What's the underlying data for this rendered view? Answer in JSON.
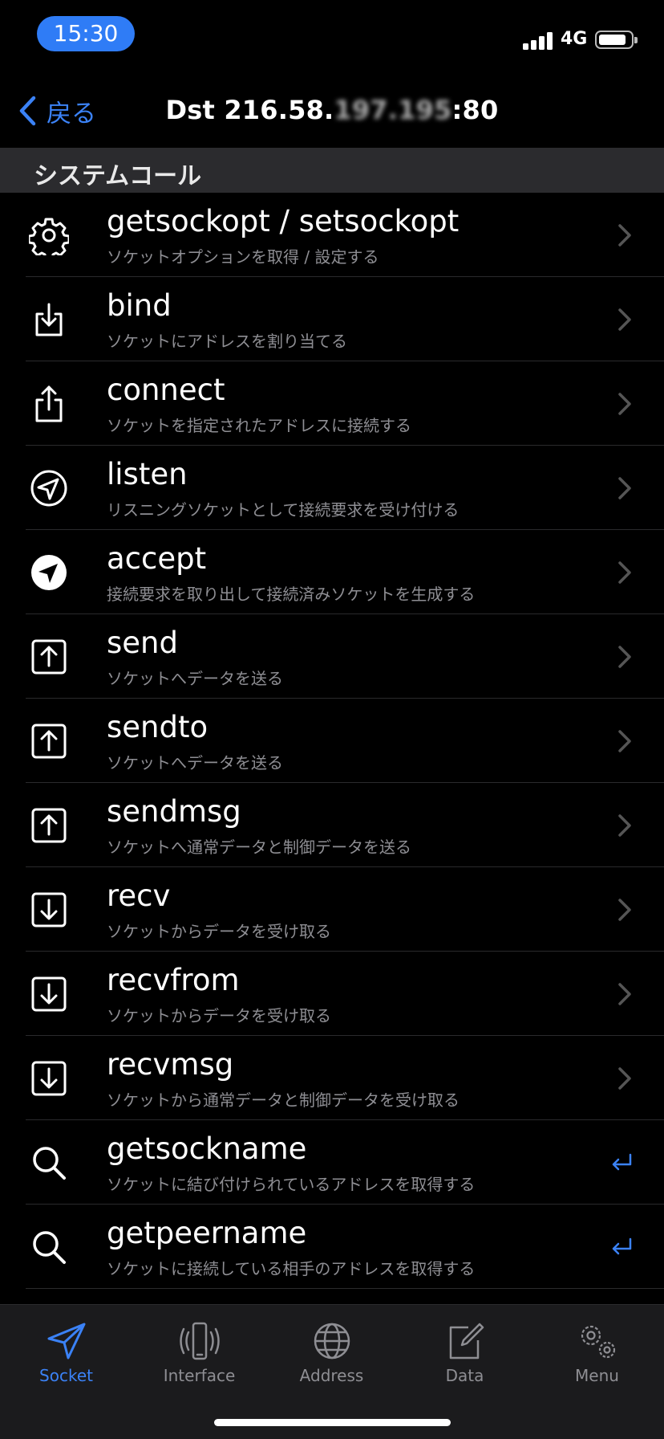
{
  "status_bar": {
    "time": "15:30",
    "network": "4G",
    "icons": [
      "signal-icon",
      "battery-icon"
    ]
  },
  "nav": {
    "back_label": "戻る",
    "title_prefix": "Dst 216.58.",
    "title_blurred": "197.195",
    "title_suffix": ":80"
  },
  "section": {
    "title": "システムコール"
  },
  "rows": [
    {
      "title": "getsockopt / setsockopt",
      "subtitle": "ソケットオプションを取得 / 設定する",
      "icon": "gear-icon",
      "accessory": "chevron"
    },
    {
      "title": "bind",
      "subtitle": "ソケットにアドレスを割り当てる",
      "icon": "tray-download-icon",
      "accessory": "chevron"
    },
    {
      "title": "connect",
      "subtitle": "ソケットを指定されたアドレスに接続する",
      "icon": "share-upload-icon",
      "accessory": "chevron"
    },
    {
      "title": "listen",
      "subtitle": "リスニングソケットとして接続要求を受け付ける",
      "icon": "location-arrow-circle-icon",
      "accessory": "chevron"
    },
    {
      "title": "accept",
      "subtitle": "接続要求を取り出して接続済みソケットを生成する",
      "icon": "location-arrow-filled-icon",
      "accessory": "chevron"
    },
    {
      "title": "send",
      "subtitle": "ソケットへデータを送る",
      "icon": "arrow-up-square-icon",
      "accessory": "chevron"
    },
    {
      "title": "sendto",
      "subtitle": "ソケットへデータを送る",
      "icon": "arrow-up-square-icon",
      "accessory": "chevron"
    },
    {
      "title": "sendmsg",
      "subtitle": "ソケットへ通常データと制御データを送る",
      "icon": "arrow-up-square-icon",
      "accessory": "chevron"
    },
    {
      "title": "recv",
      "subtitle": "ソケットからデータを受け取る",
      "icon": "arrow-down-square-icon",
      "accessory": "chevron"
    },
    {
      "title": "recvfrom",
      "subtitle": "ソケットからデータを受け取る",
      "icon": "arrow-down-square-icon",
      "accessory": "chevron"
    },
    {
      "title": "recvmsg",
      "subtitle": "ソケットから通常データと制御データを受け取る",
      "icon": "arrow-down-square-icon",
      "accessory": "chevron"
    },
    {
      "title": "getsockname",
      "subtitle": "ソケットに結び付けられているアドレスを取得する",
      "icon": "magnifier-icon",
      "accessory": "return"
    },
    {
      "title": "getpeername",
      "subtitle": "ソケットに接続している相手のアドレスを取得する",
      "icon": "magnifier-icon",
      "accessory": "return"
    }
  ],
  "tabs": [
    {
      "label": "Socket",
      "icon": "paperplane-icon",
      "active": true
    },
    {
      "label": "Interface",
      "icon": "phone-vibrate-icon",
      "active": false
    },
    {
      "label": "Address",
      "icon": "globe-icon",
      "active": false
    },
    {
      "label": "Data",
      "icon": "compose-icon",
      "active": false
    },
    {
      "label": "Menu",
      "icon": "gears-icon",
      "active": false
    }
  ],
  "colors": {
    "accent": "#3b82f6",
    "time_pill": "#2f7cf6",
    "section_bg": "#2b2b2e",
    "subtitle": "#8e8e93",
    "tab_bar_bg": "#1b1b1d"
  }
}
